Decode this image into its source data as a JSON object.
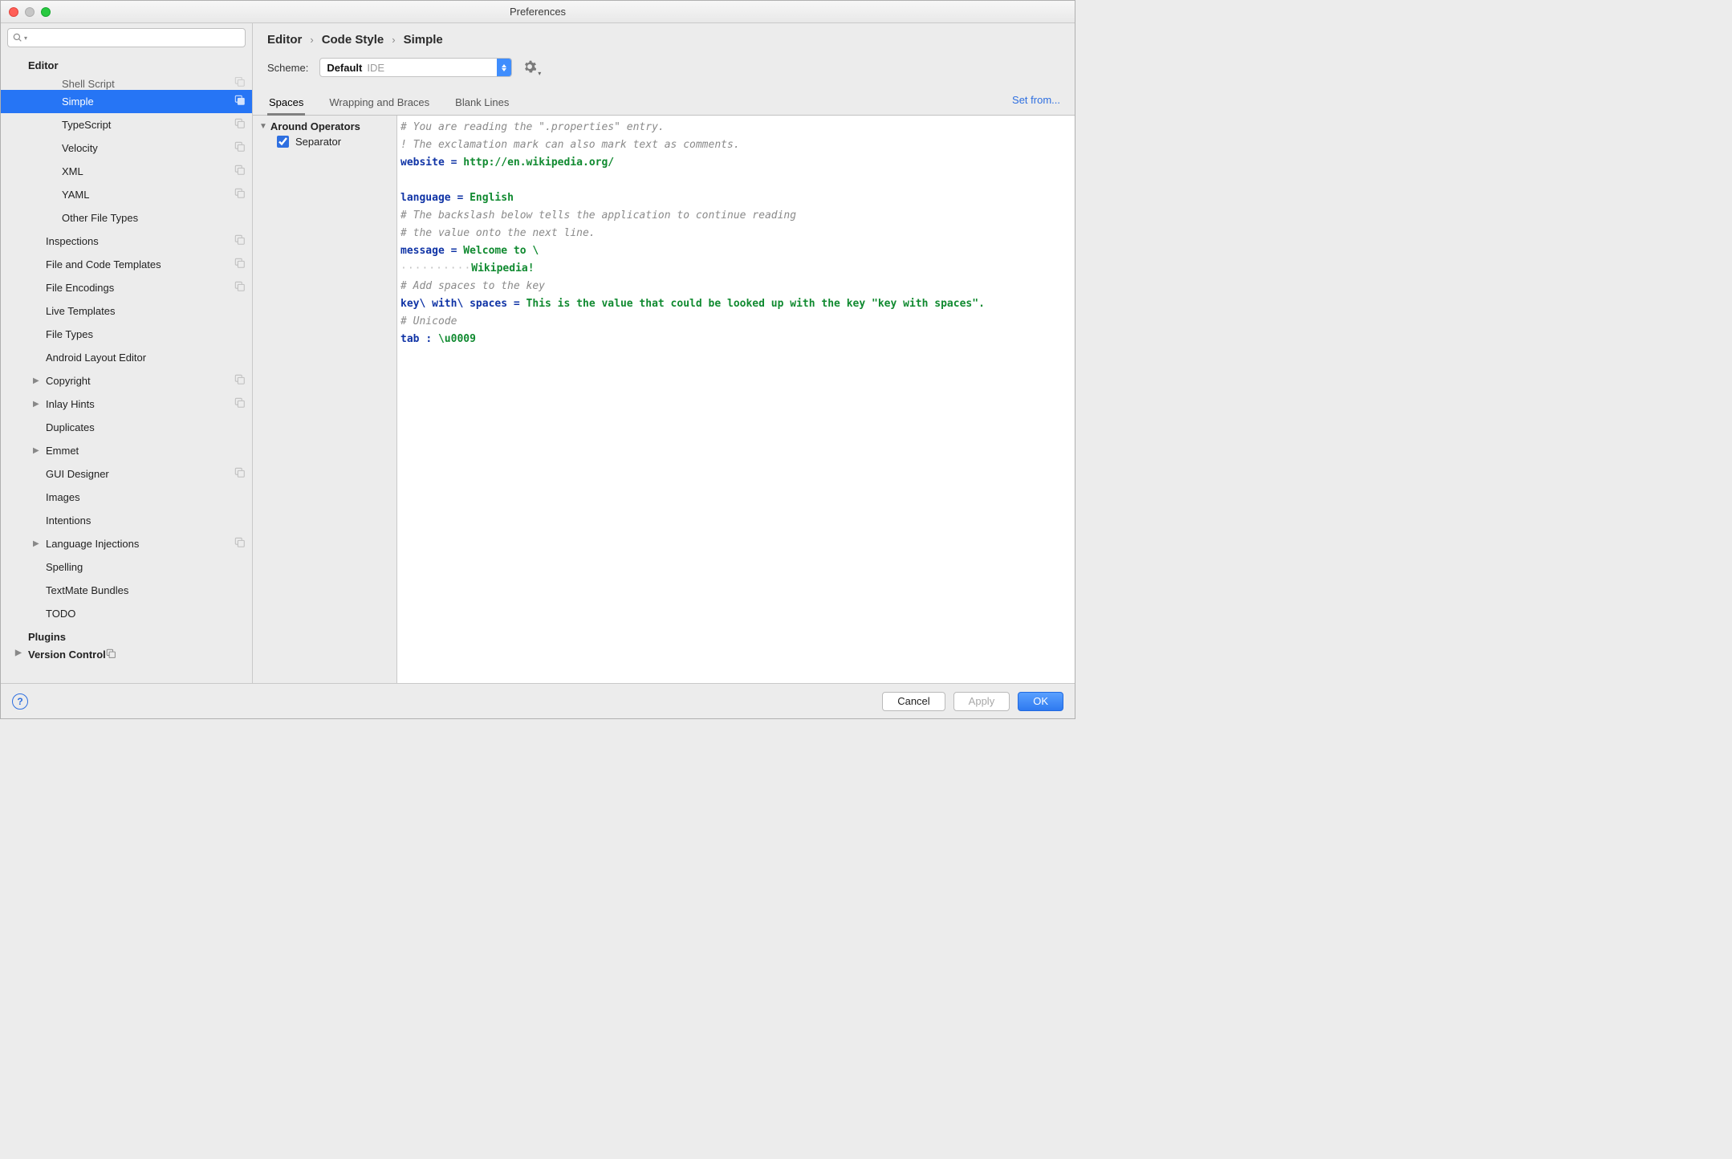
{
  "window": {
    "title": "Preferences"
  },
  "sidebar": {
    "items": [
      {
        "label": "Editor",
        "level": 0,
        "bold": true,
        "groupIcon": false,
        "arrow": ""
      },
      {
        "label": "Shell Script",
        "level": 2,
        "groupIcon": true,
        "cutTop": true
      },
      {
        "label": "Simple",
        "level": 2,
        "groupIcon": true,
        "selected": true
      },
      {
        "label": "TypeScript",
        "level": 2,
        "groupIcon": true
      },
      {
        "label": "Velocity",
        "level": 2,
        "groupIcon": true
      },
      {
        "label": "XML",
        "level": 2,
        "groupIcon": true
      },
      {
        "label": "YAML",
        "level": 2,
        "groupIcon": true
      },
      {
        "label": "Other File Types",
        "level": 2,
        "groupIcon": false
      },
      {
        "label": "Inspections",
        "level": 1,
        "groupIcon": true
      },
      {
        "label": "File and Code Templates",
        "level": 1,
        "groupIcon": true
      },
      {
        "label": "File Encodings",
        "level": 1,
        "groupIcon": true
      },
      {
        "label": "Live Templates",
        "level": 1,
        "groupIcon": false
      },
      {
        "label": "File Types",
        "level": 1,
        "groupIcon": false
      },
      {
        "label": "Android Layout Editor",
        "level": 1,
        "groupIcon": false
      },
      {
        "label": "Copyright",
        "level": 1,
        "groupIcon": true,
        "arrow": "▶"
      },
      {
        "label": "Inlay Hints",
        "level": 1,
        "groupIcon": true,
        "arrow": "▶"
      },
      {
        "label": "Duplicates",
        "level": 1,
        "groupIcon": false
      },
      {
        "label": "Emmet",
        "level": 1,
        "groupIcon": false,
        "arrow": "▶"
      },
      {
        "label": "GUI Designer",
        "level": 1,
        "groupIcon": true
      },
      {
        "label": "Images",
        "level": 1,
        "groupIcon": false
      },
      {
        "label": "Intentions",
        "level": 1,
        "groupIcon": false
      },
      {
        "label": "Language Injections",
        "level": 1,
        "groupIcon": true,
        "arrow": "▶"
      },
      {
        "label": "Spelling",
        "level": 1,
        "groupIcon": false
      },
      {
        "label": "TextMate Bundles",
        "level": 1,
        "groupIcon": false
      },
      {
        "label": "TODO",
        "level": 1,
        "groupIcon": false
      },
      {
        "label": "Plugins",
        "level": 0,
        "bold": true,
        "groupIcon": false
      },
      {
        "label": "Version Control",
        "level": 0,
        "bold": true,
        "groupIcon": true,
        "arrow": "▶",
        "cutBottom": true
      }
    ]
  },
  "breadcrumb": {
    "a": "Editor",
    "b": "Code Style",
    "c": "Simple"
  },
  "setfrom": "Set from...",
  "scheme": {
    "label": "Scheme:",
    "value": "Default",
    "scope": "IDE"
  },
  "tabs": [
    {
      "label": "Spaces",
      "active": true
    },
    {
      "label": "Wrapping and Braces"
    },
    {
      "label": "Blank Lines"
    }
  ],
  "options": {
    "group": "Around Operators",
    "items": [
      {
        "label": "Separator",
        "checked": true
      }
    ]
  },
  "preview": {
    "l1_a": "# You are reading the \".properties\" entry.",
    "l2_a": "! The exclamation mark can also mark text as comments.",
    "l3_k": "website",
    "l3_eq": " = ",
    "l3_v": "http://en.wikipedia.org/",
    "l5_k": "language",
    "l5_eq": " = ",
    "l5_v": "English",
    "l6_a": "# The backslash below tells the application to continue reading",
    "l7_a": "# the value onto the next line.",
    "l8_k": "message",
    "l8_eq": " = ",
    "l8_v": "Welcome to \\",
    "l9_dots": "··········",
    "l9_v": "Wikipedia!",
    "l10_a": "# Add spaces to the key",
    "l11_k": "key\\ with\\ spaces",
    "l11_eq": " = ",
    "l11_v": "This is the value that could be looked up with the key \"key with spaces\".",
    "l12_a": "# Unicode",
    "l13_k": "tab ",
    "l13_eq": ": ",
    "l13_v": "\\u0009"
  },
  "footer": {
    "cancel": "Cancel",
    "apply": "Apply",
    "ok": "OK"
  }
}
